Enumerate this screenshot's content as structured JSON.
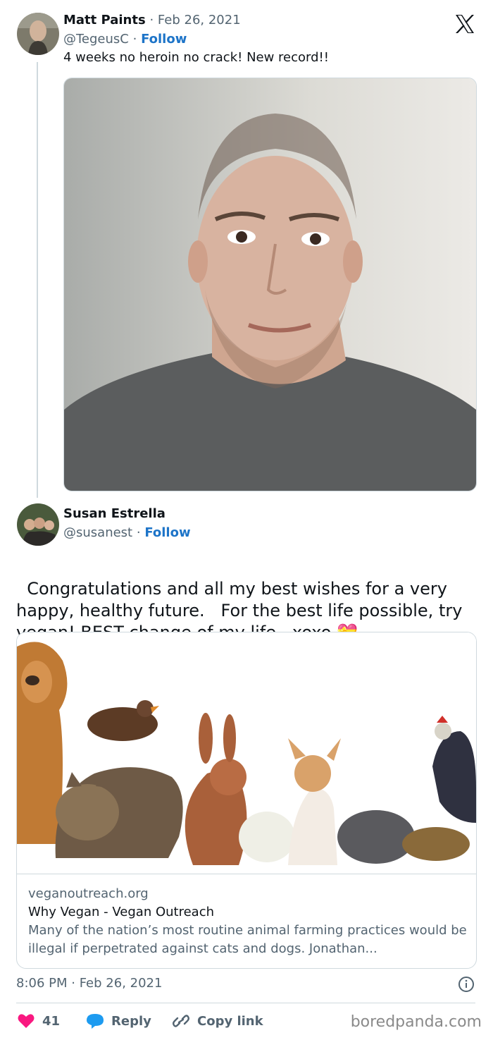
{
  "tweet1": {
    "author": "Matt Paints",
    "date": "Feb 26, 2021",
    "handle": "@TegeusC",
    "follow": "Follow",
    "text": "4 weeks no heroin no crack! New record!!"
  },
  "tweet2": {
    "author": "Susan Estrella",
    "handle": "@susanest",
    "follow": "Follow",
    "text": "Congratulations and all my best wishes for a very happy, healthy future.   For the best life possible, try vegan! BEST change of my life.  xoxo",
    "emoji": "💝",
    "card": {
      "domain": "veganoutreach.org",
      "title": "Why Vegan - Vegan Outreach",
      "description": "Many of the nation’s most routine animal farming practices would be illegal if perpetrated against cats and dogs. Jonathan..."
    },
    "timestamp": "8:06 PM · Feb 26, 2021",
    "likes": "41",
    "reply": "Reply",
    "copy_link": "Copy link"
  },
  "sep": "·",
  "watermark": "boredpanda.com",
  "colors": {
    "accent": "#1d74c8",
    "like": "#f91880",
    "reply_icon": "#1d9bf0"
  }
}
